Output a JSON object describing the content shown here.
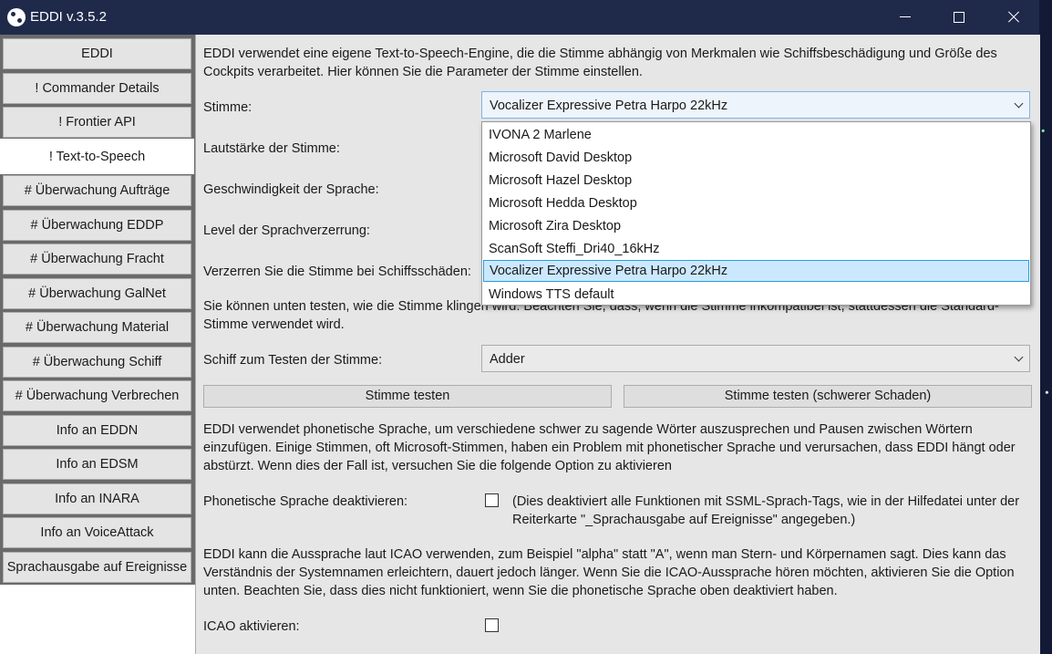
{
  "window": {
    "title": "EDDI v.3.5.2"
  },
  "sidebar": {
    "items": [
      {
        "label": "EDDI"
      },
      {
        "label": "! Commander Details"
      },
      {
        "label": "! Frontier API"
      },
      {
        "label": "! Text-to-Speech"
      },
      {
        "label": "# Überwachung Aufträge"
      },
      {
        "label": "# Überwachung EDDP"
      },
      {
        "label": "# Überwachung Fracht"
      },
      {
        "label": "# Überwachung GalNet"
      },
      {
        "label": "# Überwachung Material"
      },
      {
        "label": "# Überwachung Schiff"
      },
      {
        "label": "# Überwachung Verbrechen"
      },
      {
        "label": "Info an EDDN"
      },
      {
        "label": "Info an EDSM"
      },
      {
        "label": "Info an INARA"
      },
      {
        "label": "Info an VoiceAttack"
      },
      {
        "label": "Sprachausgabe auf Ereignisse"
      }
    ],
    "active": "! Text-to-Speech"
  },
  "tts": {
    "intro": "EDDI verwendet eine eigene Text-to-Speech-Engine, die die Stimme abhängig von Merkmalen wie Schiffsbeschädigung und Größe des Cockpits verarbeitet. Hier können Sie die Parameter der Stimme einstellen.",
    "voice_label": "Stimme:",
    "voice_value": "Vocalizer Expressive Petra Harpo 22kHz",
    "voice_options": [
      "IVONA 2 Marlene",
      "Microsoft David Desktop",
      "Microsoft Hazel Desktop",
      "Microsoft Hedda Desktop",
      "Microsoft Zira Desktop",
      "ScanSoft Steffi_Dri40_16kHz",
      "Vocalizer Expressive Petra Harpo 22kHz",
      "Windows TTS default"
    ],
    "volume_label": "Lautstärke der Stimme:",
    "speed_label": "Geschwindigkeit der Sprache:",
    "distortion_label": "Level der Sprachverzerrung:",
    "damage_label": "Verzerren Sie die Stimme bei Schiffsschäden:",
    "test_info": "Sie können unten testen, wie die Stimme klingen wird. Beachten Sie, dass, wenn die Stimme inkompatibel ist, stattdessen die Standard-Stimme verwendet wird.",
    "ship_label": "Schiff zum Testen der Stimme:",
    "ship_value": "Adder",
    "test_button": "Stimme testen",
    "test_damage_button": "Stimme testen (schwerer Schaden)",
    "phonetic_info": "EDDI verwendet phonetische Sprache, um verschiedene schwer zu sagende Wörter auszusprechen und Pausen zwischen Wörtern einzufügen. Einige Stimmen, oft Microsoft-Stimmen, haben ein Problem mit phonetischer Sprache und verursachen, dass EDDI hängt oder abstürzt. Wenn dies der Fall ist, versuchen Sie die folgende Option zu aktivieren",
    "phonetic_label": "Phonetische Sprache deaktivieren:",
    "phonetic_note": "(Dies deaktiviert alle Funktionen mit SSML-Sprach-Tags, wie in der Hilfedatei unter der Reiterkarte \"_Sprachausgabe auf Ereignisse\" angegeben.)",
    "icao_info": "EDDI kann die Aussprache laut ICAO verwenden, zum Beispiel \"alpha\" statt \"A\", wenn man Stern- und Körpernamen sagt. Dies kann das Verständnis der Systemnamen erleichtern, dauert jedoch länger. Wenn Sie die ICAO-Aussprache hören möchten, aktivieren Sie die Option unten. Beachten Sie, dass dies nicht funktioniert, wenn Sie die phonetische Sprache oben deaktiviert haben.",
    "icao_label": "ICAO aktivieren:"
  }
}
